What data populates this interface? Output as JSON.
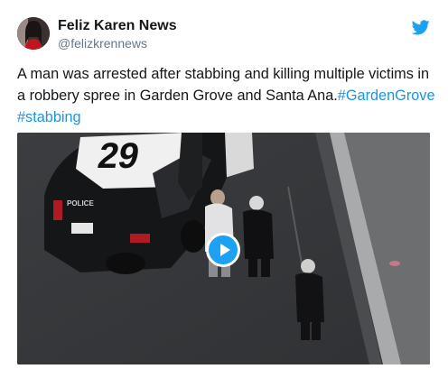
{
  "author": {
    "display_name": "Feliz Karen News",
    "handle": "@felizkrennews",
    "avatar_icon": "profile-avatar"
  },
  "header": {
    "logo_icon": "twitter-bird-icon",
    "brand_color": "#1da1f2"
  },
  "tweet": {
    "text_line1": "A man was arrested after stabbing and killing multiple victims in",
    "text_line2_plain": "a robbery spree in Garden Grove and Santa Ana.",
    "hashtag1": "#GardenGrove",
    "hashtag2": "#stabbing",
    "hashtag_color": "#1b95e0"
  },
  "media": {
    "type": "video",
    "play_icon": "play-icon",
    "car_number": "29",
    "door_text": "POLICE"
  }
}
